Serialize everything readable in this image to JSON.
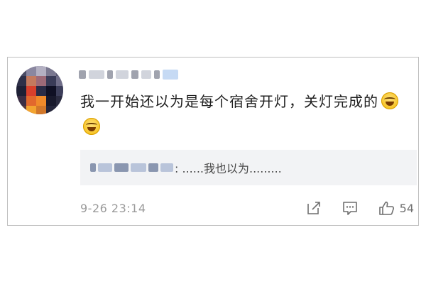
{
  "comment": {
    "text": "我一开始还以为是每个宿舍开灯，关灯完成的",
    "emojis": [
      "laughing-tears-emoji",
      "laughing-tears-emoji"
    ]
  },
  "reply": {
    "text": ": ......我也以为........."
  },
  "footer": {
    "timestamp": "9-26 23:14",
    "like_count": "54"
  },
  "icons": {
    "edit": "edit-icon",
    "reply": "comment-icon",
    "like": "thumbs-up-icon"
  },
  "colors": {
    "text": "#1f1f1f",
    "meta": "#9a9a9a",
    "reply_bg": "#f2f3f5",
    "border": "#bfbfbf"
  }
}
